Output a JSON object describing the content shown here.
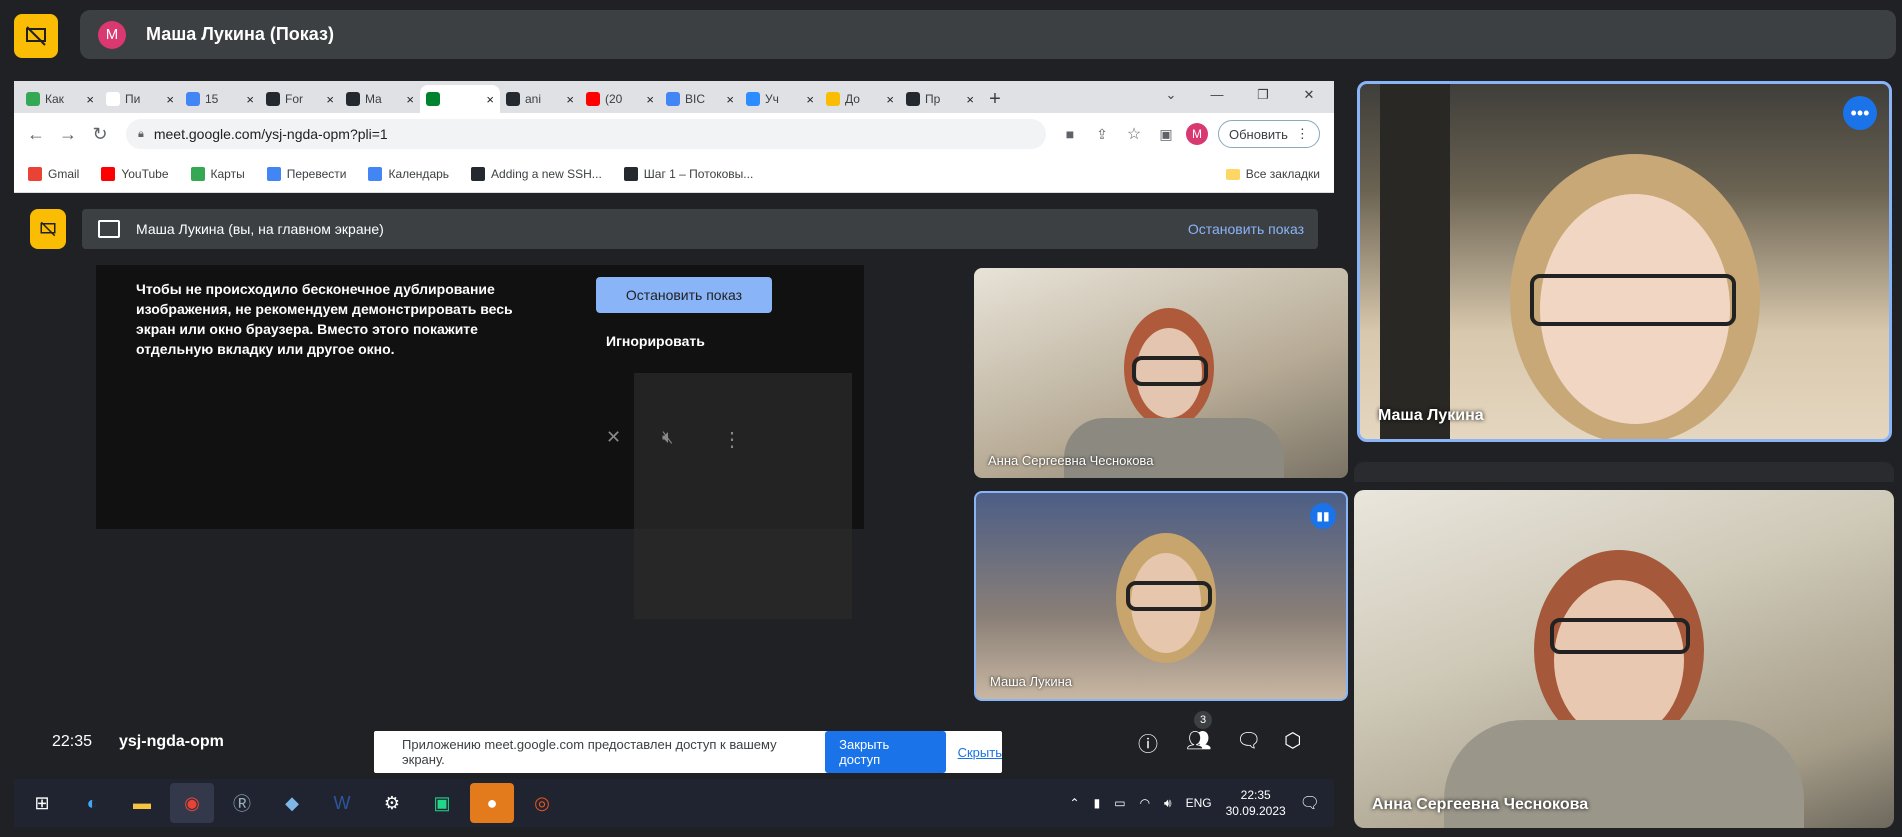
{
  "presenter_bar": {
    "avatar_letter": "M",
    "title": "Маша Лукина (Показ)"
  },
  "browser": {
    "tabs": [
      {
        "label": "Как",
        "color": "#34a853"
      },
      {
        "label": "Пи",
        "color": "#ffffff"
      },
      {
        "label": "15",
        "color": "#4285f4"
      },
      {
        "label": "For",
        "color": "#24292f"
      },
      {
        "label": "Ma",
        "color": "#24292f"
      },
      {
        "label": "",
        "color": "#00832d",
        "active": true
      },
      {
        "label": "ani",
        "color": "#24292f"
      },
      {
        "label": "(20",
        "color": "#ff0000"
      },
      {
        "label": "BIC",
        "color": "#4285f4"
      },
      {
        "label": "Уч",
        "color": "#2d8cff"
      },
      {
        "label": "До",
        "color": "#fbbc04"
      },
      {
        "label": "Пр",
        "color": "#24292f"
      }
    ],
    "tab_close": "×",
    "new_tab": "+",
    "url": "meet.google.com/ysj-ngda-opm?pli=1",
    "update_button": "Обновить",
    "avatar_letter": "M",
    "bookmarks": [
      {
        "label": "Gmail",
        "color": "#ea4335"
      },
      {
        "label": "YouTube",
        "color": "#ff0000"
      },
      {
        "label": "Карты",
        "color": "#34a853"
      },
      {
        "label": "Перевести",
        "color": "#4285f4"
      },
      {
        "label": "Календарь",
        "color": "#4285f4"
      },
      {
        "label": "Adding a new SSH...",
        "color": "#24292f"
      },
      {
        "label": "Шаг 1 – Потоковы...",
        "color": "#24292f"
      }
    ],
    "all_bookmarks": "Все закладки"
  },
  "inner_meet": {
    "banner_text": "Маша Лукина (вы, на главном экране)",
    "banner_stop": "Остановить показ",
    "warning_text": "Чтобы не происходило бесконечное дублирование изображения, не рекомендуем демонстрировать весь экран или окно браузера. Вместо этого покажите отдельную вкладку или другое окно.",
    "warning_stop": "Остановить показ",
    "warning_ignore": "Игнорировать",
    "tile_anna": "Анна Сергеевна Чеснокова",
    "tile_masha": "Маша Лукина",
    "clock": "22:35",
    "meeting_code": "ysj-ngda-opm",
    "share_notice": "Приложению meet.google.com предоставлен доступ к вашему экрану.",
    "share_close": "Закрыть доступ",
    "share_hide": "Скрыть",
    "participants_badge": "3"
  },
  "taskbar": {
    "lang": "ENG",
    "time": "22:35",
    "date": "30.09.2023"
  },
  "right_tiles": {
    "top_name": "Маша Лукина",
    "bottom_name": "Анна Сергеевна Чеснокова"
  }
}
